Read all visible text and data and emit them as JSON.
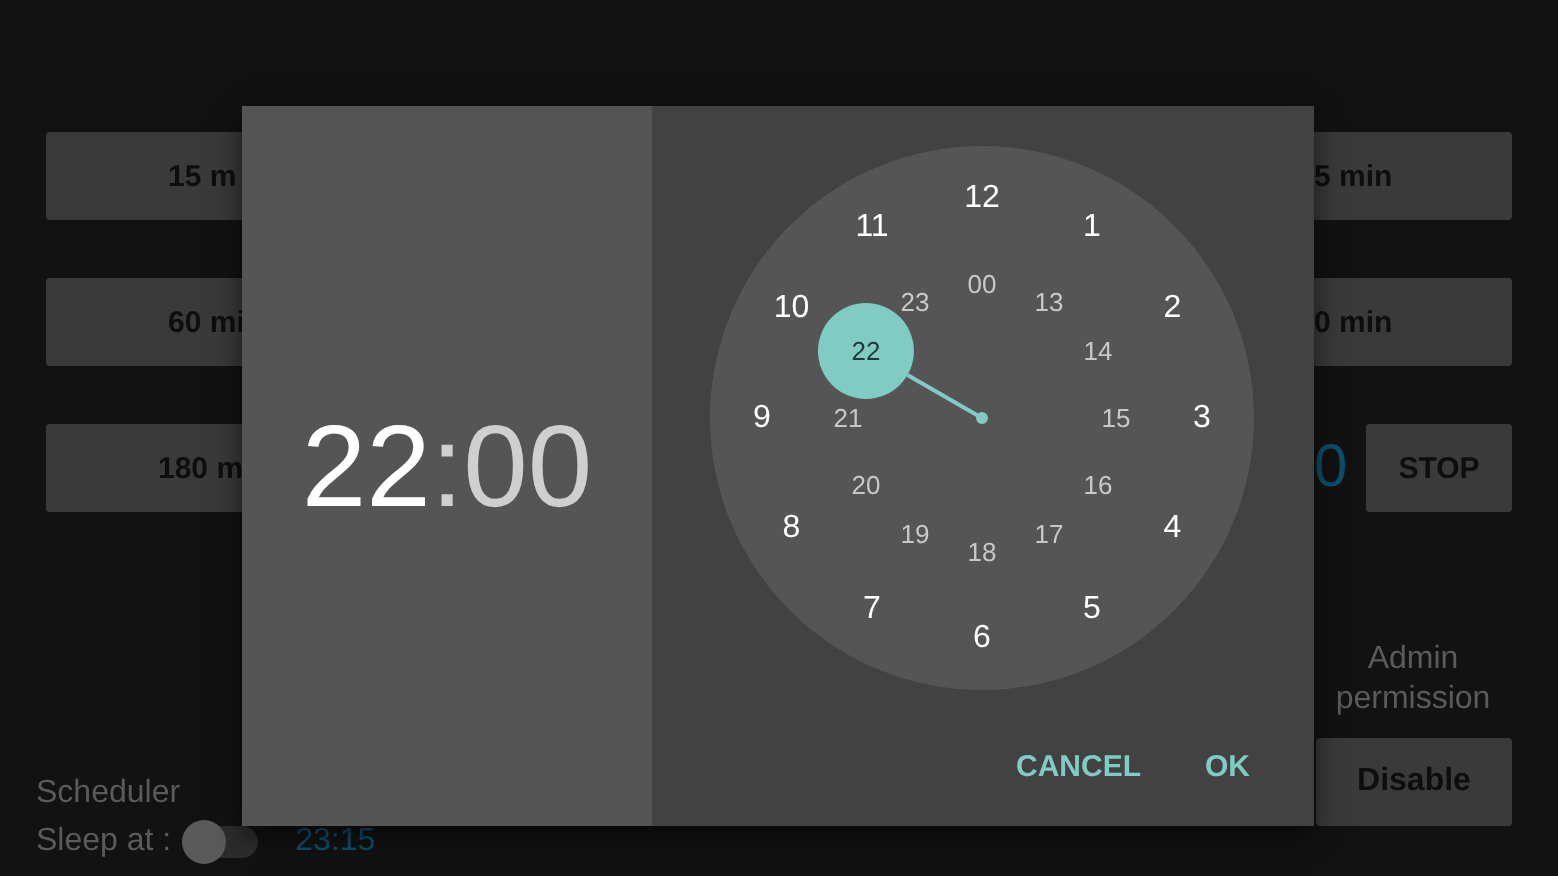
{
  "background": {
    "left_buttons": [
      "15 m",
      "60 mi",
      "180 m"
    ],
    "right_buttons": [
      "5 min",
      "0 min"
    ],
    "timer_reading": "0",
    "stop_button": "STOP",
    "admin_label": "Admin permission",
    "disable_button": "Disable",
    "scheduler": {
      "title": "Scheduler",
      "label": "Sleep at :",
      "on": false,
      "time": "23:15"
    }
  },
  "dialog": {
    "hour": {
      "text": "22",
      "selected": true
    },
    "separator": ":",
    "minute": {
      "text": "00",
      "selected": false
    },
    "outer_ring": [
      {
        "label": "12",
        "selected": false
      },
      {
        "label": "1",
        "selected": false
      },
      {
        "label": "2",
        "selected": false
      },
      {
        "label": "3",
        "selected": false
      },
      {
        "label": "4",
        "selected": false
      },
      {
        "label": "5",
        "selected": false
      },
      {
        "label": "6",
        "selected": false
      },
      {
        "label": "7",
        "selected": false
      },
      {
        "label": "8",
        "selected": false
      },
      {
        "label": "9",
        "selected": false
      },
      {
        "label": "10",
        "selected": false
      },
      {
        "label": "11",
        "selected": false
      }
    ],
    "inner_ring": [
      {
        "label": "00",
        "selected": false
      },
      {
        "label": "13",
        "selected": false
      },
      {
        "label": "14",
        "selected": false
      },
      {
        "label": "15",
        "selected": false
      },
      {
        "label": "16",
        "selected": false
      },
      {
        "label": "17",
        "selected": false
      },
      {
        "label": "18",
        "selected": false
      },
      {
        "label": "19",
        "selected": false
      },
      {
        "label": "20",
        "selected": false
      },
      {
        "label": "21",
        "selected": false
      },
      {
        "label": "22",
        "selected": true
      },
      {
        "label": "23",
        "selected": false
      }
    ],
    "buttons": [
      "CANCEL",
      "OK"
    ]
  }
}
